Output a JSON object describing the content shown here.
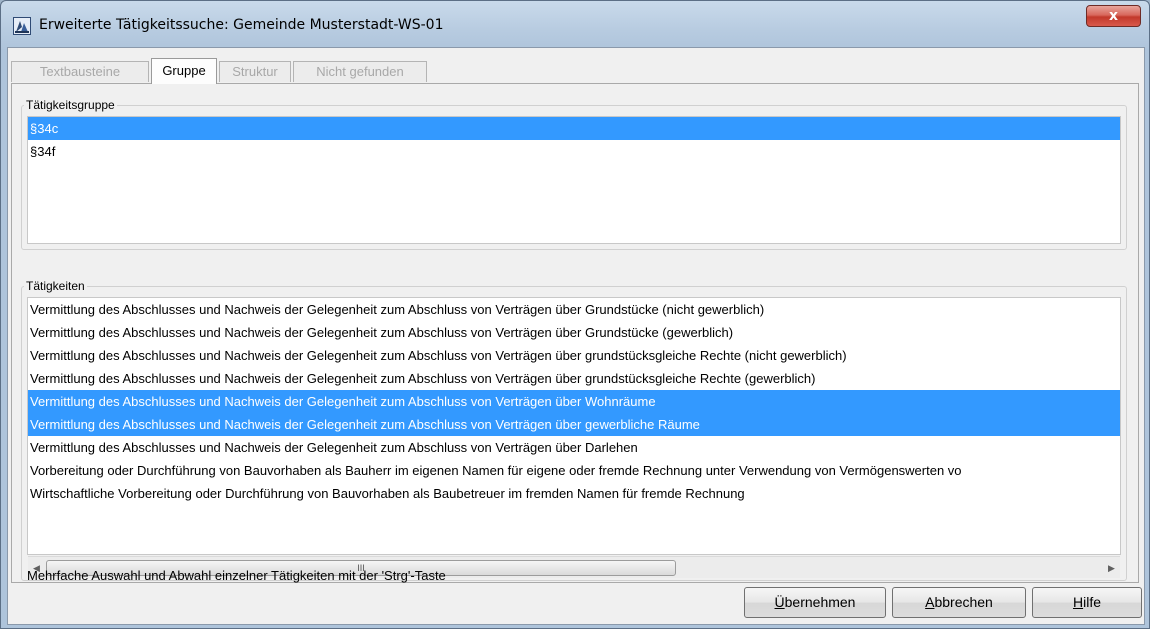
{
  "window": {
    "title": "Erweiterte Tätigkeitssuche: Gemeinde Musterstadt-WS-01",
    "close_label": "x"
  },
  "tabs": [
    {
      "label": "Textbausteine",
      "enabled": false
    },
    {
      "label": "Gruppe",
      "enabled": true,
      "active": true
    },
    {
      "label": "Struktur",
      "enabled": false
    },
    {
      "label": "Nicht gefunden",
      "enabled": false
    }
  ],
  "group_section": {
    "legend": "Tätigkeitsgruppe",
    "items": [
      {
        "label": "§34c",
        "selected": true
      },
      {
        "label": "§34f",
        "selected": false
      }
    ]
  },
  "activities_section": {
    "legend": "Tätigkeiten",
    "items": [
      {
        "label": "Vermittlung des Abschlusses und Nachweis der Gelegenheit zum Abschluss von Verträgen über Grundstücke (nicht gewerblich)",
        "selected": false
      },
      {
        "label": "Vermittlung des Abschlusses und Nachweis der Gelegenheit zum Abschluss von Verträgen über Grundstücke (gewerblich)",
        "selected": false
      },
      {
        "label": "Vermittlung des Abschlusses und Nachweis der Gelegenheit zum Abschluss von Verträgen über grundstücksgleiche Rechte (nicht gewerblich)",
        "selected": false
      },
      {
        "label": "Vermittlung des Abschlusses und Nachweis der Gelegenheit zum Abschluss von Verträgen über grundstücksgleiche Rechte (gewerblich)",
        "selected": false
      },
      {
        "label": "Vermittlung des Abschlusses und Nachweis der Gelegenheit zum Abschluss von Verträgen über Wohnräume",
        "selected": true
      },
      {
        "label": "Vermittlung des Abschlusses und Nachweis der Gelegenheit zum Abschluss von Verträgen über gewerbliche Räume",
        "selected": true
      },
      {
        "label": "Vermittlung des Abschlusses und Nachweis der Gelegenheit zum Abschluss von Verträgen über Darlehen",
        "selected": false
      },
      {
        "label": "Vorbereitung oder Durchführung von Bauvorhaben als Bauherr im eigenen Namen für eigene oder fremde Rechnung unter Verwendung von Vermögenswerten vo",
        "selected": false
      },
      {
        "label": "Wirtschaftliche Vorbereitung oder Durchführung von Bauvorhaben als Baubetreuer im fremden Namen für fremde Rechnung",
        "selected": false
      }
    ],
    "scrollbar": {
      "left_arrow": "◀",
      "right_arrow": "▶",
      "thumb_grip": "III"
    }
  },
  "status_text": "Mehrfache Auswahl und Abwahl einzelner Tätigkeiten mit der 'Strg'-Taste",
  "buttons": {
    "apply": {
      "first": "Ü",
      "rest": "bernehmen"
    },
    "cancel": {
      "first": "A",
      "rest": "bbrechen"
    },
    "help": {
      "first": "H",
      "rest": "ilfe"
    }
  },
  "colors": {
    "selection": "#3399ff",
    "close_button": "#c2392b"
  },
  "icons": {
    "app": "app-logo-icon",
    "close": "close-icon"
  }
}
